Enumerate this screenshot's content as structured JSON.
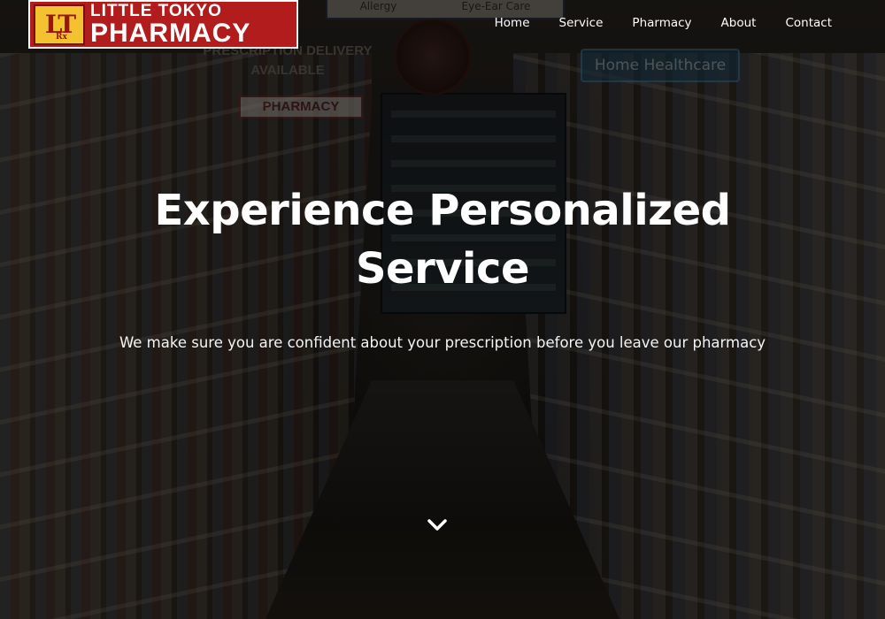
{
  "brand": {
    "logo_mark": "LT",
    "logo_mark_small": "Rx",
    "name_line1": "LITTLE TOKYO",
    "name_line2": "PHARMACY",
    "color": "#b31c1c"
  },
  "nav": {
    "items": [
      {
        "label": "Home"
      },
      {
        "label": "Service"
      },
      {
        "label": "Pharmacy"
      },
      {
        "label": "About"
      },
      {
        "label": "Contact"
      }
    ]
  },
  "background_signs": {
    "delivery_line1": "PRESCRIPTION DELIVERY",
    "delivery_line2": "AVAILABLE",
    "shelf_sign": "PHARMACY",
    "home_healthcare": "Home Healthcare",
    "allergy": "Allergy",
    "eye_ear_care": "Eye-Ear Care"
  },
  "hero": {
    "title_line1": "Experience Personalized",
    "title_line2": "Service",
    "subtitle": "We make sure you are confident about your prescription before you leave our pharmacy",
    "scroll_icon": "chevron-down-icon"
  }
}
